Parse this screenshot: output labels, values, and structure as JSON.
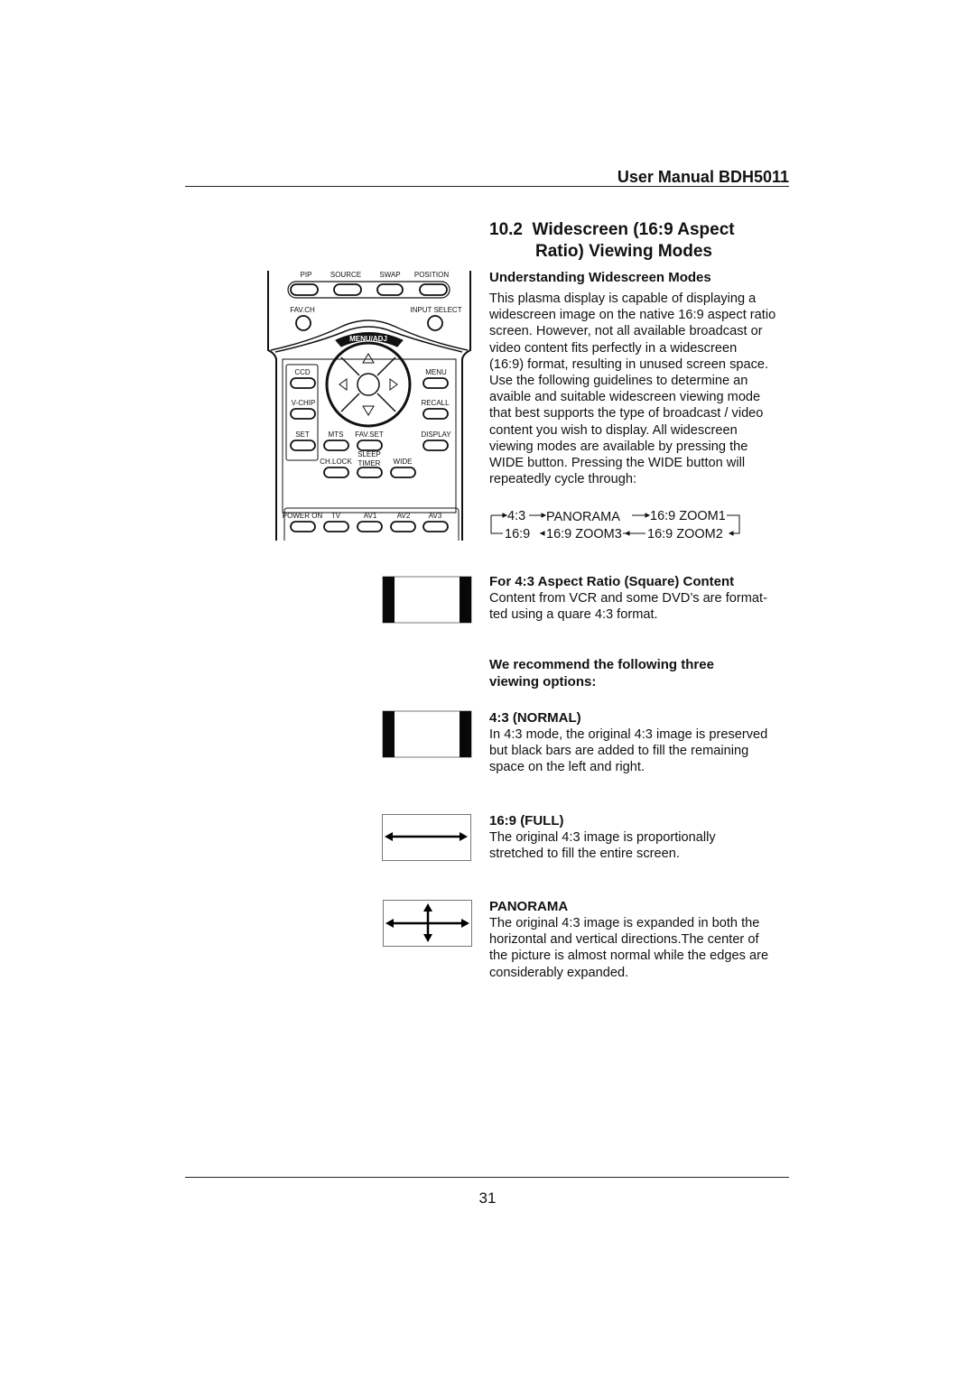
{
  "header": {
    "title": "User Manual BDH5011"
  },
  "section": {
    "number": "10.2",
    "title_line1": "Widescreen (16:9 Aspect",
    "title_line2": "Ratio) Viewing Modes"
  },
  "understanding": {
    "heading": "Understanding Widescreen Modes",
    "lines": [
      "This plasma display is capable of displaying a",
      "widescreen image on the native 16:9 aspect ratio",
      "screen. However, not all available broadcast or",
      "video content fits perfectly in a widescreen",
      "(16:9) format, resulting in unused screen space.",
      "Use the following guidelines to determine an",
      "avaible and suitable widescreen viewing mode",
      "that best supports the type of broadcast / video",
      "content you wish to display.  All widescreen",
      "viewing modes are available by pressing the",
      "WIDE button. Pressing the WIDE button will",
      "repeatedly cycle through:"
    ]
  },
  "cycle": {
    "row1": [
      "4:3",
      "PANORAMA",
      "16:9 ZOOM1"
    ],
    "row2": [
      "16:9",
      "16:9 ZOOM3",
      "16:9 ZOOM2"
    ]
  },
  "square": {
    "heading": "For 4:3 Aspect Ratio (Square) Content",
    "lines": [
      "Content from VCR and some DVD’s are format-",
      "ted using a quare 4:3 format."
    ]
  },
  "recommend": {
    "lines": [
      "We recommend the following three",
      "viewing options:"
    ]
  },
  "normal": {
    "heading": "4:3 (NORMAL)",
    "lines": [
      "In 4:3 mode, the original 4:3 image is preserved",
      "but black bars are added to fill the remaining",
      "space on the left and right."
    ]
  },
  "full": {
    "heading": "16:9 (FULL)",
    "lines": [
      "The original 4:3 image is proportionally",
      "stretched to fill the entire screen."
    ]
  },
  "panorama": {
    "heading": "PANORAMA",
    "lines": [
      "The original 4:3 image is expanded in both the",
      "horizontal and vertical directions.The center of",
      "the picture is almost normal while the edges are",
      "considerably expanded."
    ]
  },
  "remote": {
    "pip": "PIP",
    "source": "SOURCE",
    "swap": "SWAP",
    "position": "POSITION",
    "favch": "FAV.CH",
    "input_select": "INPUT SELECT",
    "menu_adj": "MENU/ADJ",
    "ccd": "CCD",
    "vchip": "V-CHIP",
    "set": "SET",
    "mts": "MTS",
    "favset": "FAV.SET",
    "menu": "MENU",
    "recall": "RECALL",
    "display": "DISPLAY",
    "chlock": "CH.LOCK",
    "sleep": "SLEEP",
    "timer": "TIMER",
    "wide": "WIDE",
    "power_on": "POWER ON",
    "tv": "TV",
    "av1": "AV1",
    "av2": "AV2",
    "av3": "AV3"
  },
  "page_number": "31"
}
